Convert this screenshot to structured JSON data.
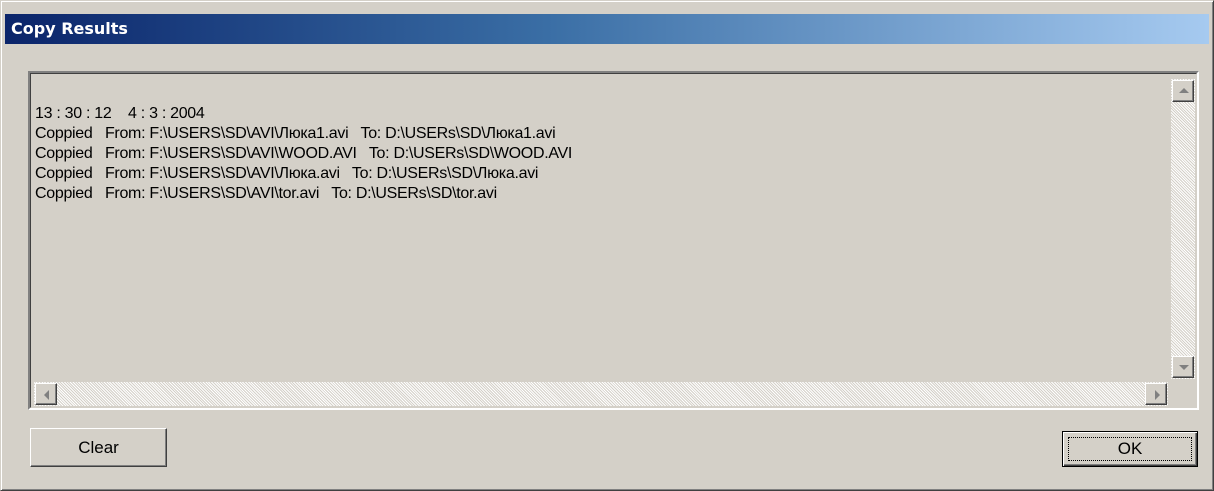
{
  "window": {
    "title": "Copy Results",
    "title_color": "#0a246a"
  },
  "log": {
    "lines": [
      "13 : 30 : 12    4 : 3 : 2004",
      "Coppied   From: F:\\USERS\\SD\\AVI\\Люка1.avi   To: D:\\USERs\\SD\\Люка1.avi",
      "Coppied   From: F:\\USERS\\SD\\AVI\\WOOD.AVI   To: D:\\USERs\\SD\\WOOD.AVI",
      "Coppied   From: F:\\USERS\\SD\\AVI\\Люка.avi   To: D:\\USERs\\SD\\Люка.avi",
      "Coppied   From: F:\\USERS\\SD\\AVI\\tor.avi   To: D:\\USERs\\SD\\tor.avi"
    ]
  },
  "buttons": {
    "clear_label": "Clear",
    "ok_label": "OK"
  },
  "icons": {
    "scroll_up": "arrow-up-icon",
    "scroll_down": "arrow-down-icon",
    "scroll_left": "arrow-left-icon",
    "scroll_right": "arrow-right-icon"
  }
}
